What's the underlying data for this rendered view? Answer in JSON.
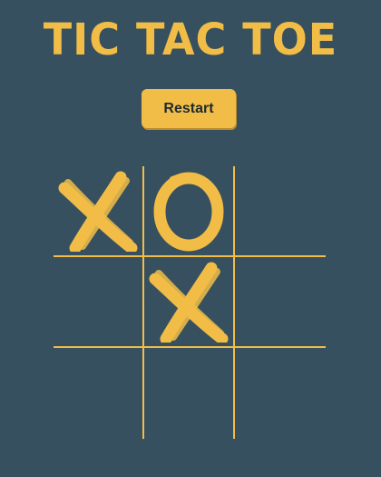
{
  "title": "TIC TAC TOE",
  "restart_label": "Restart",
  "colors": {
    "background": "#37505f",
    "accent": "#f1bd46",
    "button_text": "#1e2a30"
  },
  "board": [
    [
      "X",
      "O",
      ""
    ],
    [
      "",
      "X",
      ""
    ],
    [
      "",
      "",
      ""
    ]
  ]
}
